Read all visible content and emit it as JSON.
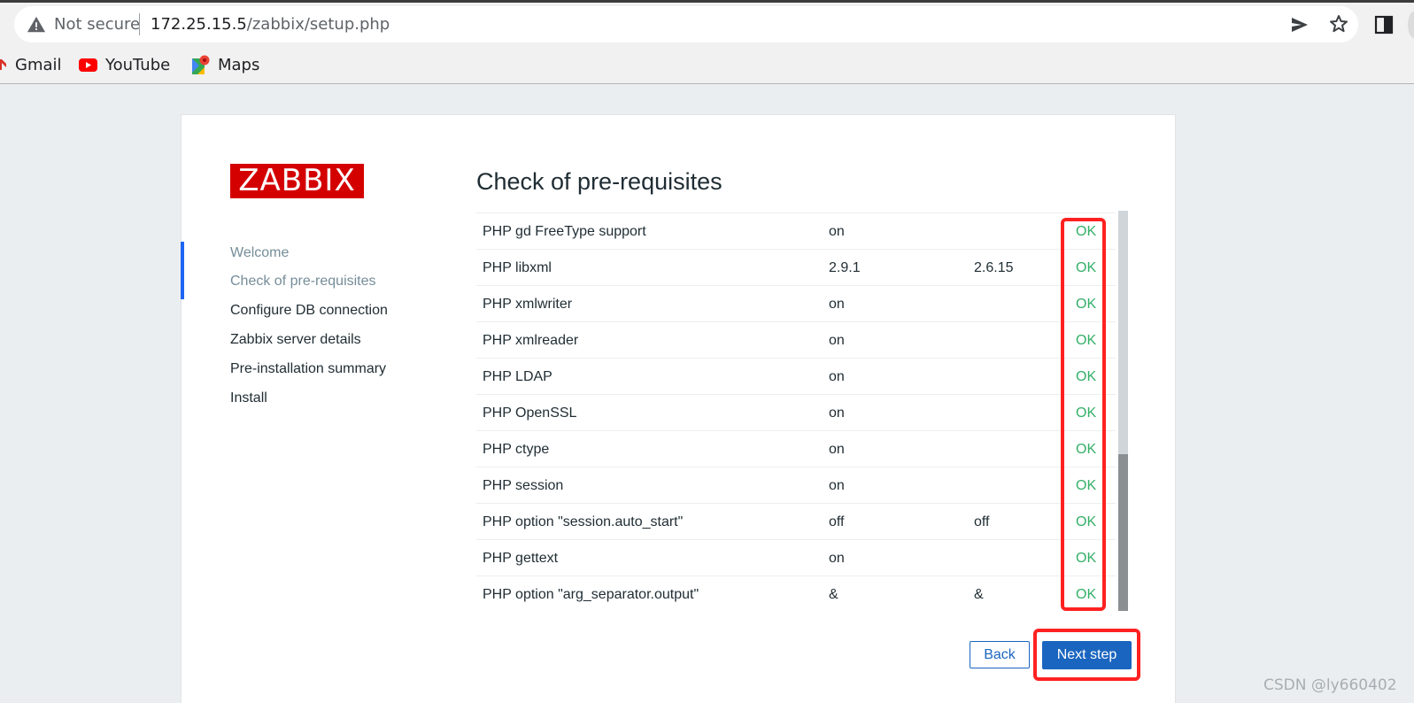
{
  "browser": {
    "security_label": "Not secure",
    "url_host": "172.25.15.5",
    "url_path": "/zabbix/setup.php",
    "bookmarks": [
      {
        "label": "Gmail",
        "icon": "gmail-icon"
      },
      {
        "label": "YouTube",
        "icon": "youtube-icon"
      },
      {
        "label": "Maps",
        "icon": "maps-icon"
      }
    ]
  },
  "logo": {
    "text": "ZABBIX",
    "color": "#d40000"
  },
  "steps": [
    {
      "label": "Welcome",
      "status": "done"
    },
    {
      "label": "Check of pre-requisites",
      "status": "current"
    },
    {
      "label": "Configure DB connection",
      "status": "pending"
    },
    {
      "label": "Zabbix server details",
      "status": "pending"
    },
    {
      "label": "Pre-installation summary",
      "status": "pending"
    },
    {
      "label": "Install",
      "status": "pending"
    }
  ],
  "page_title": "Check of pre-requisites",
  "requirements": [
    {
      "name": "PHP gd FreeType support",
      "current": "on",
      "required": "",
      "result": "OK"
    },
    {
      "name": "PHP libxml",
      "current": "2.9.1",
      "required": "2.6.15",
      "result": "OK"
    },
    {
      "name": "PHP xmlwriter",
      "current": "on",
      "required": "",
      "result": "OK"
    },
    {
      "name": "PHP xmlreader",
      "current": "on",
      "required": "",
      "result": "OK"
    },
    {
      "name": "PHP LDAP",
      "current": "on",
      "required": "",
      "result": "OK"
    },
    {
      "name": "PHP OpenSSL",
      "current": "on",
      "required": "",
      "result": "OK"
    },
    {
      "name": "PHP ctype",
      "current": "on",
      "required": "",
      "result": "OK"
    },
    {
      "name": "PHP session",
      "current": "on",
      "required": "",
      "result": "OK"
    },
    {
      "name": "PHP option \"session.auto_start\"",
      "current": "off",
      "required": "off",
      "result": "OK"
    },
    {
      "name": "PHP gettext",
      "current": "on",
      "required": "",
      "result": "OK"
    },
    {
      "name": "PHP option \"arg_separator.output\"",
      "current": "&",
      "required": "&",
      "result": "OK"
    }
  ],
  "buttons": {
    "back": "Back",
    "next": "Next step"
  },
  "watermark": "CSDN @ly660402",
  "colors": {
    "ok": "#34af67",
    "highlight": "#ff2121",
    "primary": "#1a65bf"
  }
}
